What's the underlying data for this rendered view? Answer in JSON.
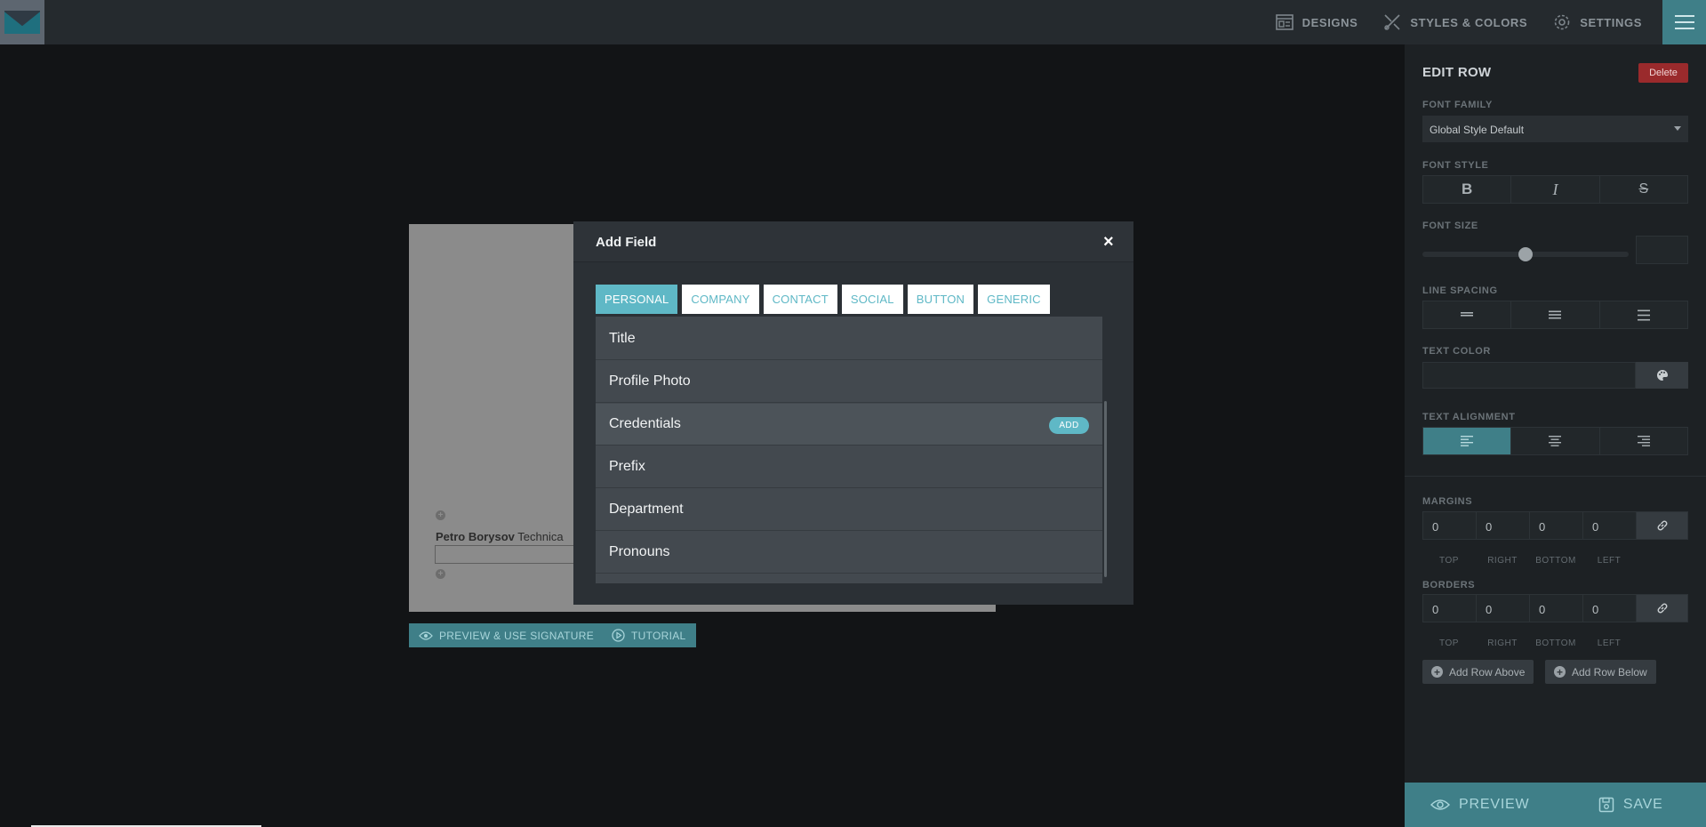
{
  "topbar": {
    "nav": [
      {
        "label": "DESIGNS",
        "icon": "layout-icon"
      },
      {
        "label": "STYLES & COLORS",
        "icon": "brush-icon"
      },
      {
        "label": "SETTINGS",
        "icon": "gear-icon"
      }
    ]
  },
  "panel": {
    "title": "EDIT ROW",
    "delete_label": "Delete",
    "font_family_label": "FONT FAMILY",
    "font_family_value": "Global Style Default",
    "font_style_label": "FONT STYLE",
    "font_style_buttons": [
      "B",
      "I",
      "S"
    ],
    "font_size_label": "FONT SIZE",
    "font_size_value": 0.5,
    "line_spacing_label": "LINE SPACING",
    "text_color_label": "TEXT COLOR",
    "text_alignment_label": "TEXT ALIGNMENT",
    "text_alignment_selected": "left",
    "margins_label": "MARGINS",
    "margins": {
      "values": [
        "0",
        "0",
        "0",
        "0"
      ],
      "labels": [
        "TOP",
        "RIGHT",
        "BOTTOM",
        "LEFT"
      ]
    },
    "borders_label": "BORDERS",
    "borders": {
      "values": [
        "0",
        "0",
        "0",
        "0"
      ],
      "labels": [
        "TOP",
        "RIGHT",
        "BOTTOM",
        "LEFT"
      ]
    },
    "add_row_above": "Add Row Above",
    "add_row_below": "Add Row Below",
    "preview_label": "PREVIEW",
    "save_label": "SAVE"
  },
  "editor": {
    "name": "Petro Borysov",
    "title_fragment": "Technica",
    "preview_button": "PREVIEW & USE SIGNATURE",
    "tutorial_button": "TUTORIAL"
  },
  "modal": {
    "title": "Add Field",
    "close": "×",
    "tabs": [
      "PERSONAL",
      "COMPANY",
      "CONTACT",
      "SOCIAL",
      "BUTTON",
      "GENERIC"
    ],
    "active_tab": "PERSONAL",
    "items": [
      "Title",
      "Profile Photo",
      "Credentials",
      "Prefix",
      "Department",
      "Pronouns"
    ],
    "hovered_item": "Credentials",
    "add_badge": "ADD"
  },
  "colors": {
    "accent": "#5fb8c6",
    "teal": "#3f7f88",
    "danger": "#9a2a2c"
  }
}
